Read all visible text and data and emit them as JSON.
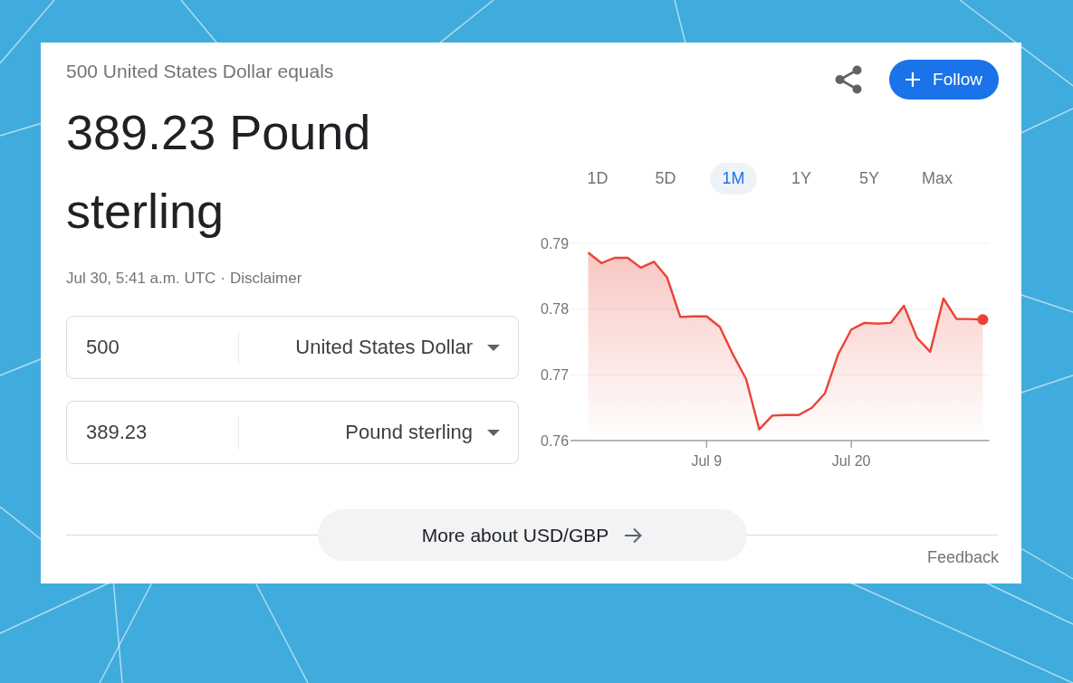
{
  "header": {
    "subtitle": "500 United States Dollar equals",
    "result": "389.23 Pound sterling",
    "timestamp": "Jul 30, 5:41 a.m. UTC",
    "separator": "·",
    "disclaimer": "Disclaimer"
  },
  "actions": {
    "follow": "Follow"
  },
  "converter": [
    {
      "amount": "500",
      "currency": "United States Dollar"
    },
    {
      "amount": "389.23",
      "currency": "Pound sterling"
    }
  ],
  "range_tabs": [
    {
      "label": "1D",
      "selected": false
    },
    {
      "label": "5D",
      "selected": false
    },
    {
      "label": "1M",
      "selected": true
    },
    {
      "label": "1Y",
      "selected": false
    },
    {
      "label": "5Y",
      "selected": false
    },
    {
      "label": "Max",
      "selected": false
    }
  ],
  "chart": {
    "chart_data": {
      "type": "area",
      "categories": [
        null,
        null,
        null,
        null,
        null,
        null,
        null,
        null,
        null,
        "Jul 9",
        null,
        null,
        null,
        null,
        null,
        null,
        null,
        null,
        null,
        null,
        "Jul 20",
        null,
        null,
        null,
        null,
        null,
        null,
        null,
        null,
        null,
        null
      ],
      "series": [
        {
          "color": "#ea4335",
          "values": [
            0.7886,
            0.787,
            0.7878,
            0.7878,
            0.7863,
            0.7872,
            0.7848,
            0.7788,
            0.7789,
            0.7789,
            0.7773,
            0.7731,
            0.7694,
            0.7617,
            0.7638,
            0.7639,
            0.7639,
            0.765,
            0.7672,
            0.7731,
            0.7769,
            0.7779,
            0.7778,
            0.7779,
            0.7805,
            0.7756,
            0.7735,
            0.7816,
            0.7785,
            0.7785,
            0.7784
          ]
        }
      ],
      "ylim": [
        0.76,
        0.79
      ],
      "yticks": [
        0.76,
        0.77,
        0.78,
        0.79
      ]
    }
  },
  "more_button": "More about USD/GBP",
  "feedback": "Feedback"
}
